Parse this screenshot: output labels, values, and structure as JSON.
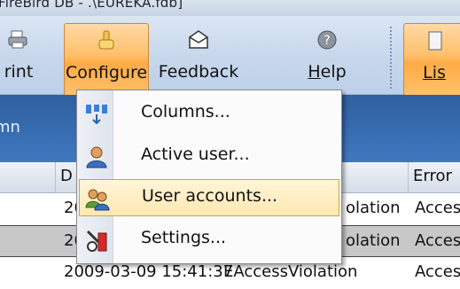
{
  "window": {
    "title": "FireBird DB - .\\EUREKA.fdb]"
  },
  "toolbar": {
    "buttons": [
      {
        "id": "print",
        "label": "rint"
      },
      {
        "id": "configure",
        "label": "Configure"
      },
      {
        "id": "feedback",
        "label": "Feedback"
      },
      {
        "id": "help",
        "label_prefix": "",
        "label_underline": "H",
        "label_rest": "elp"
      },
      {
        "id": "list",
        "label_underline": "Lis"
      }
    ]
  },
  "grid": {
    "group_hint": "mn",
    "headers": {
      "date": "D",
      "error": "Error"
    },
    "rows": [
      {
        "date": "20",
        "type": "olation",
        "error": "Acces"
      },
      {
        "date": "20",
        "type": "olation",
        "error": "Acces"
      },
      {
        "date": "2009-03-09 15:41:37",
        "type": "EAccessViolation",
        "error": "Acces"
      }
    ]
  },
  "menu": {
    "items": [
      {
        "label": "Columns...",
        "icon": "columns-icon"
      },
      {
        "label": "Active user...",
        "icon": "active-user-icon"
      },
      {
        "label": "User accounts...",
        "icon": "user-accounts-icon"
      },
      {
        "label": "Settings...",
        "icon": "settings-icon"
      }
    ]
  }
}
